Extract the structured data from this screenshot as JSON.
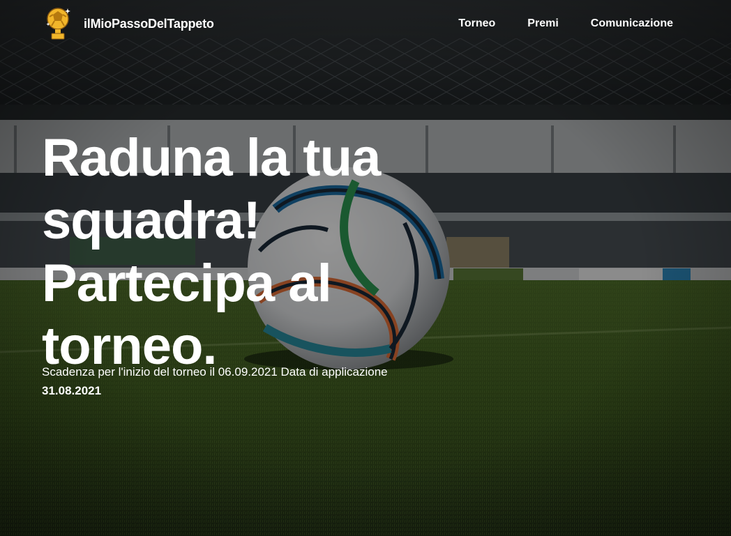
{
  "brand": {
    "name": "ilMioPassoDelTappeto",
    "logo_icon": "trophy-football-icon"
  },
  "nav": {
    "items": [
      {
        "label": "Torneo"
      },
      {
        "label": "Premi"
      },
      {
        "label": "Comunicazione"
      }
    ]
  },
  "hero": {
    "headline_lines": [
      "Raduna la tua",
      "squadra!",
      "Partecipa al",
      "torneo."
    ],
    "subtext": "Scadenza per l'inizio del torneo il 06.09.2021 Data di applicazione",
    "application_date": "31.08.2021",
    "background_icon": "stadium-football-photo"
  },
  "colors": {
    "text": "#ffffff",
    "logo_gold": "#f2b62a",
    "grass": "#3f5a1e",
    "overlay": "#000000"
  }
}
